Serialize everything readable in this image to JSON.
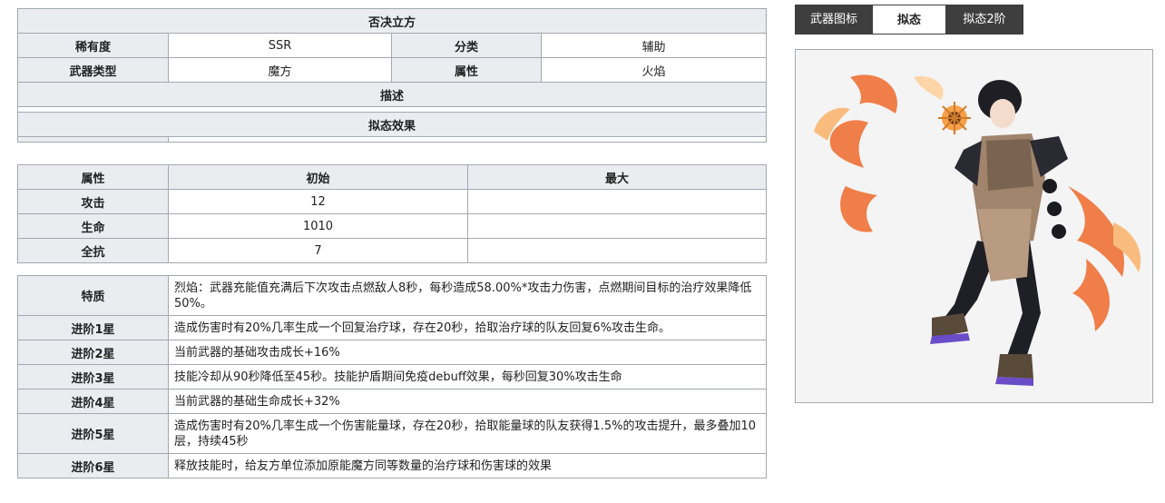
{
  "info_table": {
    "title": "否决立方",
    "rarity_label": "稀有度",
    "rarity_value": "SSR",
    "category_label": "分类",
    "category_value": "辅助",
    "weapon_type_label": "武器类型",
    "weapon_type_value": "魔方",
    "attribute_label": "属性",
    "attribute_value": "火焰",
    "description_label": "描述",
    "mimic_effect_label": "拟态效果"
  },
  "stats_table": {
    "headers": [
      "属性",
      "初始",
      "最大"
    ],
    "rows": [
      {
        "label": "攻击",
        "initial": "12",
        "max": ""
      },
      {
        "label": "生命",
        "initial": "1010",
        "max": ""
      },
      {
        "label": "全抗",
        "initial": "7",
        "max": ""
      }
    ]
  },
  "traits_table": {
    "rows": [
      {
        "label": "特质",
        "text": "烈焰：武器充能值充满后下次攻击点燃敌人8秒，每秒造成58.00%*攻击力伤害，点燃期间目标的治疗效果降低50%。"
      },
      {
        "label": "进阶1星",
        "text": "造成伤害时有20%几率生成一个回复治疗球，存在20秒，拾取治疗球的队友回复6%攻击生命。"
      },
      {
        "label": "进阶2星",
        "text": "当前武器的基础攻击成长+16%"
      },
      {
        "label": "进阶3星",
        "text": "技能冷却从90秒降低至45秒。技能护盾期间免疫debuff效果，每秒回复30%攻击生命"
      },
      {
        "label": "进阶4星",
        "text": "当前武器的基础生命成长+32%"
      },
      {
        "label": "进阶5星",
        "text": "造成伤害时有20%几率生成一个伤害能量球，存在20秒，拾取能量球的队友获得1.5%的攻击提升，最多叠加10层，持续45秒"
      },
      {
        "label": "进阶6星",
        "text": "释放技能时，给友方单位添加原能魔方同等数量的治疗球和伤害球的效果"
      }
    ]
  },
  "tabs": [
    {
      "label": "武器图标",
      "active": false
    },
    {
      "label": "拟态",
      "active": true
    },
    {
      "label": "拟态2阶",
      "active": false
    }
  ],
  "colors": {
    "header_bg": "#eaecf0",
    "border": "#a2a9b1",
    "tab_dark": "#3e3e3e",
    "flame_orange": "#f06a2a"
  }
}
